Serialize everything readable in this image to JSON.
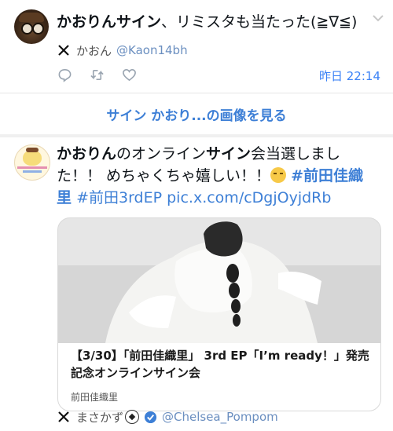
{
  "tweet1": {
    "text_name": "かおりんサイン",
    "text_rest": "、リミスタも当たった(≧∇≦)",
    "author_name": "かおん",
    "author_handle": "@Kaon14bh",
    "time": "昨日 22:14"
  },
  "see_more": "サイン かおり...の画像を見る",
  "tweet2": {
    "p1": "かおりん",
    "p2": "のオンライン",
    "p3": "サイン",
    "p4": "会当選しました！！ めちゃくちゃ嬉しい！！",
    "hashtag1": "#前田佳織里",
    "hashtag2": "#前田3rdEP",
    "link": "pic.x.com/cDgjOyjdRb",
    "card_title": "【3/30】「前田佳織里」 3rd EP「I’m ready！」発売記念オンラインサイン会",
    "card_source": "前田佳織里",
    "author_name": "まさかず",
    "author_handle": "@Chelsea_Pompom"
  },
  "colors": {
    "accent": "#3d7fd6",
    "handle": "#6b8fc0",
    "time": "#3b82f6"
  },
  "icons": [
    "x-logo-icon",
    "reply-icon",
    "retweet-icon",
    "like-icon",
    "chevron-down-icon",
    "verified-icon",
    "crying-face-emoji",
    "soccer-ball-emoji"
  ]
}
